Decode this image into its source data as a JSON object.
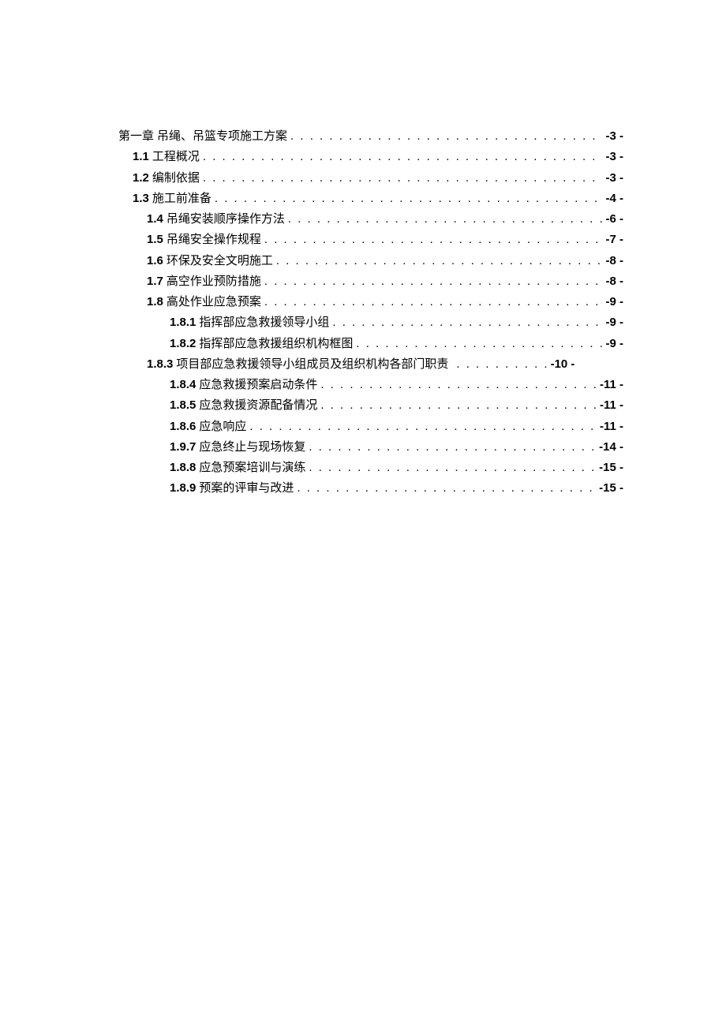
{
  "toc": [
    {
      "indent": 0,
      "number": "第一章",
      "title": "吊绳、吊篮专项施工方案",
      "page": "-3 -",
      "chapter": true
    },
    {
      "indent": 1,
      "number": "1.1",
      "title": "工程概况",
      "page": "-3 -"
    },
    {
      "indent": 1,
      "number": "1.2",
      "title": "编制依据",
      "page": "-3 -"
    },
    {
      "indent": 1,
      "number": "1.3",
      "title": "施工前准备",
      "page": "-4 -"
    },
    {
      "indent": 2,
      "number": "1.4",
      "title": "吊绳安装顺序操作方法",
      "page": "-6 -"
    },
    {
      "indent": 2,
      "number": "1.5",
      "title": "吊绳安全操作规程",
      "page": "-7 -"
    },
    {
      "indent": 2,
      "number": "1.6",
      "title": "环保及安全文明施工",
      "page": "-8 -"
    },
    {
      "indent": 2,
      "number": "1.7",
      "title": "高空作业预防措施",
      "page": "-8 -"
    },
    {
      "indent": 2,
      "number": "1.8",
      "title": "高处作业应急预案",
      "page": "-9 -"
    },
    {
      "indent": 3,
      "number": "1.8.1",
      "title": "指挥部应急救援领导小组",
      "page": "-9 -"
    },
    {
      "indent": 3,
      "number": "1.8.2",
      "title": "指挥部应急救援组织机构框图",
      "page": "-9 -"
    },
    {
      "indent": 2,
      "number": "1.8.3",
      "title": "项目部应急救援领导小组成员及组织机构各部门职责",
      "page": "-10 -",
      "shortdots": true
    },
    {
      "indent": 3,
      "number": "1.8.4",
      "title": "应急救援预案启动条件",
      "page": "-11 -"
    },
    {
      "indent": 3,
      "number": "1.8.5",
      "title": "应急救援资源配备情况",
      "page": "-11 -"
    },
    {
      "indent": 3,
      "number": "1.8.6",
      "title": "应急响应",
      "page": "-11 -"
    },
    {
      "indent": 3,
      "number": "1.9.7",
      "title": "应急终止与现场恢复",
      "page": "-14 -"
    },
    {
      "indent": 3,
      "number": "1.8.8",
      "title": "应急预案培训与演练",
      "page": "-15 -"
    },
    {
      "indent": 3,
      "number": "1.8.9",
      "title": "预案的评审与改进",
      "page": "-15 -"
    }
  ],
  "dots": ". . . . . . . . . . . . . . . . . . . . . . . . . . . . . . . . . . . . . . . . . . . . . . . . . . . . . . . . . . . . . . . . . . . . . . . . . . . . . . . . . . . . . . . . . . . . . . . . . . . .",
  "shortdots": ". . . . . . . . . ."
}
